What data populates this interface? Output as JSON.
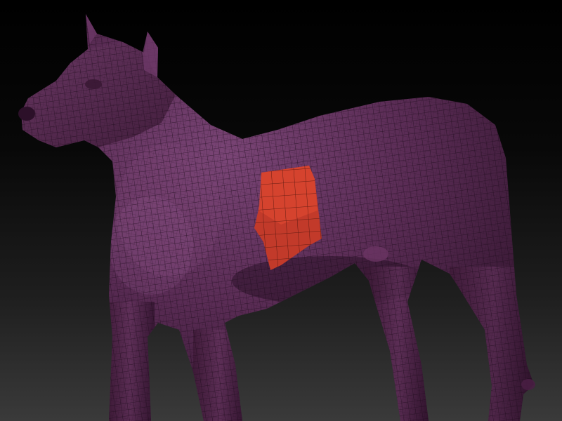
{
  "viewport": {
    "background_top": "#000000",
    "background_bottom": "#3a3a3a"
  },
  "model": {
    "subject": "dog",
    "display_mode": "polyframe-wireframe",
    "base_color": "#5a2c55",
    "shadow_color": "#2a1026",
    "highlight_color": "#7a4576",
    "wire_color": "#1a0a18",
    "selected_polygroup_color": "#c23a2a",
    "selection_highlight_color": "#e14a32"
  }
}
